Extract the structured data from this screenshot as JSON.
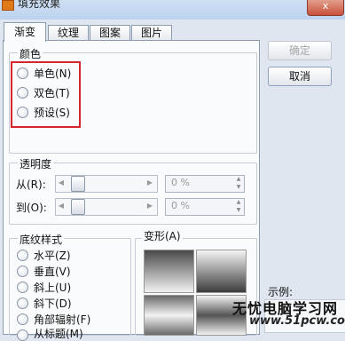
{
  "window": {
    "title": "填充效果",
    "close_label": "x"
  },
  "tabs": [
    {
      "label": "渐变"
    },
    {
      "label": "纹理"
    },
    {
      "label": "图案"
    },
    {
      "label": "图片"
    }
  ],
  "colors_group": {
    "legend": "颜色",
    "options": [
      {
        "label": "单色(N)"
      },
      {
        "label": "双色(T)"
      },
      {
        "label": "预设(S)"
      }
    ]
  },
  "transparency_group": {
    "legend": "透明度",
    "from_label": "从(R):",
    "to_label": "到(O):",
    "from_value": "0 %",
    "to_value": "0 %"
  },
  "shading_group": {
    "legend": "底纹样式",
    "options": [
      {
        "label": "水平(Z)"
      },
      {
        "label": "垂直(V)"
      },
      {
        "label": "斜上(U)"
      },
      {
        "label": "斜下(D)"
      },
      {
        "label": "角部辐射(F)"
      },
      {
        "label": "从标题(M)"
      }
    ]
  },
  "variants_group": {
    "legend": "变形(A)"
  },
  "buttons": {
    "ok": "确定",
    "cancel": "取消"
  },
  "sample_label": "示例:",
  "watermark": {
    "line1": "无忧电脑学习网",
    "line2": "www.51pcw.com"
  }
}
